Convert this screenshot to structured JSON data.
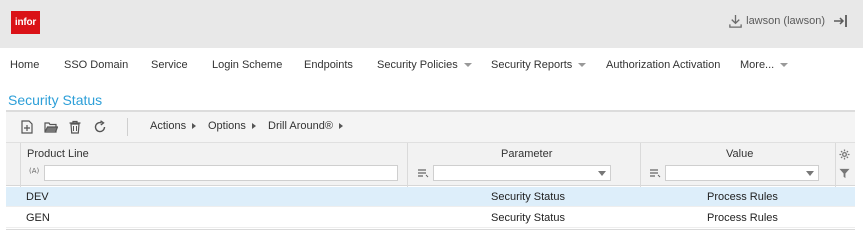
{
  "header": {
    "logo": "infor",
    "user_label": "lawson (lawson)"
  },
  "nav": {
    "items": [
      {
        "label": "Home",
        "has_menu": false
      },
      {
        "label": "SSO Domain",
        "has_menu": false
      },
      {
        "label": "Service",
        "has_menu": false
      },
      {
        "label": "Login Scheme",
        "has_menu": false
      },
      {
        "label": "Endpoints",
        "has_menu": false
      },
      {
        "label": "Security Policies",
        "has_menu": true
      },
      {
        "label": "Security Reports",
        "has_menu": true
      },
      {
        "label": "Authorization Activation",
        "has_menu": false
      },
      {
        "label": "More...",
        "has_menu": true
      }
    ]
  },
  "page": {
    "title": "Security Status"
  },
  "toolbar": {
    "icons": [
      "new-record-icon",
      "open-folder-icon",
      "delete-icon",
      "refresh-icon"
    ],
    "menus": [
      "Actions",
      "Options",
      "Drill Around®"
    ]
  },
  "grid": {
    "columns": [
      "Product Line",
      "Parameter",
      "Value"
    ],
    "filter_op_text": "(A)",
    "rows": [
      {
        "product_line": "DEV",
        "parameter": "Security Status",
        "value": "Process Rules",
        "selected": true
      },
      {
        "product_line": "GEN",
        "parameter": "Security Status",
        "value": "Process Rules",
        "selected": false
      }
    ]
  },
  "colors": {
    "brand_red": "#da1217",
    "title_blue": "#2d9fd8",
    "selected_row": "#ddeefa"
  }
}
